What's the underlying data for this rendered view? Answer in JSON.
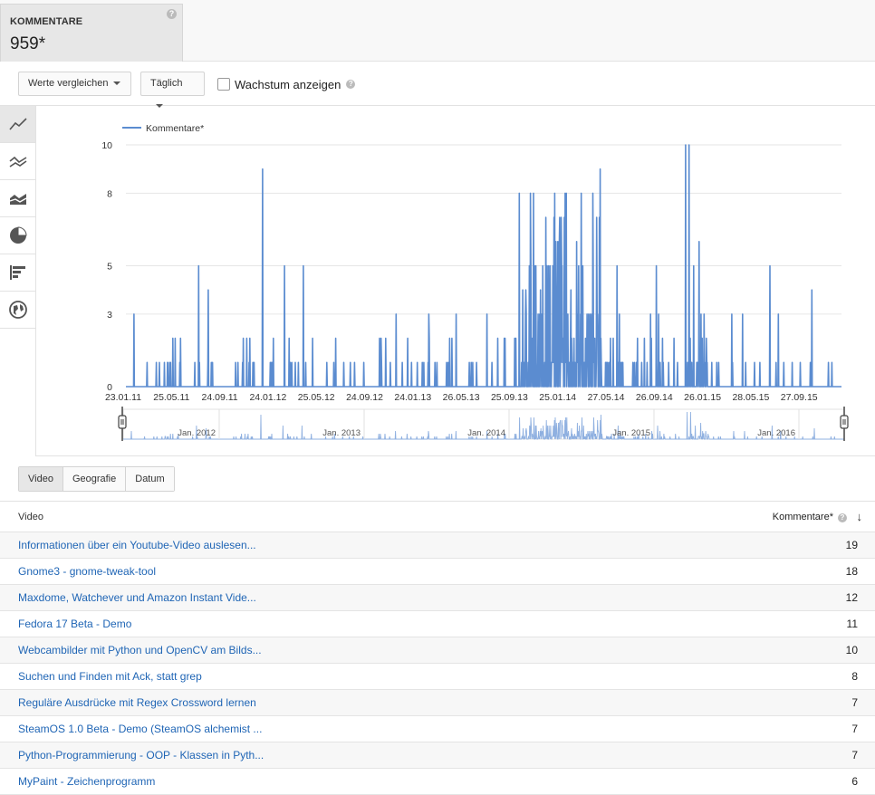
{
  "metric": {
    "label": "KOMMENTARE",
    "value": "959*",
    "help": "?"
  },
  "toolbar": {
    "compare_label": "Werte vergleichen",
    "period_label": "Täglich",
    "growth_label": "Wachstum anzeigen",
    "growth_checked": false,
    "help": "?"
  },
  "sidebar": {
    "icons": [
      "line-chart-icon",
      "multi-line-chart-icon",
      "area-chart-icon",
      "pie-chart-icon",
      "bar-chart-icon",
      "globe-icon"
    ],
    "active": "line-chart-icon"
  },
  "chart_data": {
    "type": "line",
    "series": [
      {
        "name": "Kommentare*",
        "color": "#5b8cd0"
      }
    ],
    "y_ticks": [
      "0",
      "3",
      "5",
      "8",
      "10"
    ],
    "ylim": [
      0,
      10
    ],
    "x_tick_labels": [
      "23.01.11",
      "25.05.11",
      "24.09.11",
      "24.01.12",
      "25.05.12",
      "24.09.12",
      "24.01.13",
      "26.05.13",
      "25.09.13",
      "25.01.14",
      "27.05.14",
      "26.09.14",
      "26.01.15",
      "28.05.15",
      "27.09.15"
    ],
    "x_range": [
      "2011-01-23",
      "2016-02-28"
    ],
    "navigator_labels": [
      "Jan. 2012",
      "Jan. 2013",
      "Jan. 2014",
      "Jan. 2015",
      "Jan. 2016"
    ],
    "peaks": [
      {
        "date": "2012-01-13",
        "value": 9
      },
      {
        "date": "2011-08-25",
        "value": 4
      },
      {
        "date": "2012-04-28",
        "value": 5
      },
      {
        "date": "2013-11-10",
        "value": 8
      },
      {
        "date": "2014-02-10",
        "value": 8
      },
      {
        "date": "2014-04-20",
        "value": 8
      },
      {
        "date": "2014-06-08",
        "value": 9
      },
      {
        "date": "2015-01-16",
        "value": 10
      },
      {
        "date": "2015-01-25",
        "value": 10
      },
      {
        "date": "2015-02-20",
        "value": 6
      },
      {
        "date": "2015-12-10",
        "value": 4
      }
    ],
    "legend_position": "top-left",
    "grid": true
  },
  "tabs": [
    {
      "label": "Video",
      "active": true
    },
    {
      "label": "Geografie",
      "active": false
    },
    {
      "label": "Datum",
      "active": false
    }
  ],
  "table": {
    "col_video": "Video",
    "col_count": "Kommentare*",
    "sort_arrow": "↓",
    "rows": [
      {
        "title": "Informationen über ein Youtube-Video auslesen...",
        "count": "19"
      },
      {
        "title": "Gnome3 - gnome-tweak-tool",
        "count": "18"
      },
      {
        "title": "Maxdome, Watchever und Amazon Instant Vide...",
        "count": "12"
      },
      {
        "title": "Fedora 17 Beta - Demo",
        "count": "11"
      },
      {
        "title": "Webcambilder mit Python und OpenCV am Bilds...",
        "count": "10"
      },
      {
        "title": "Suchen und Finden mit Ack, statt grep",
        "count": "8"
      },
      {
        "title": "Reguläre Ausdrücke mit Regex Crossword lernen",
        "count": "7"
      },
      {
        "title": "SteamOS 1.0 Beta - Demo (SteamOS alchemist ...",
        "count": "7"
      },
      {
        "title": "Python-Programmierung - OOP - Klassen in Pyth...",
        "count": "7"
      },
      {
        "title": "MyPaint - Zeichenprogramm",
        "count": "6"
      }
    ]
  }
}
